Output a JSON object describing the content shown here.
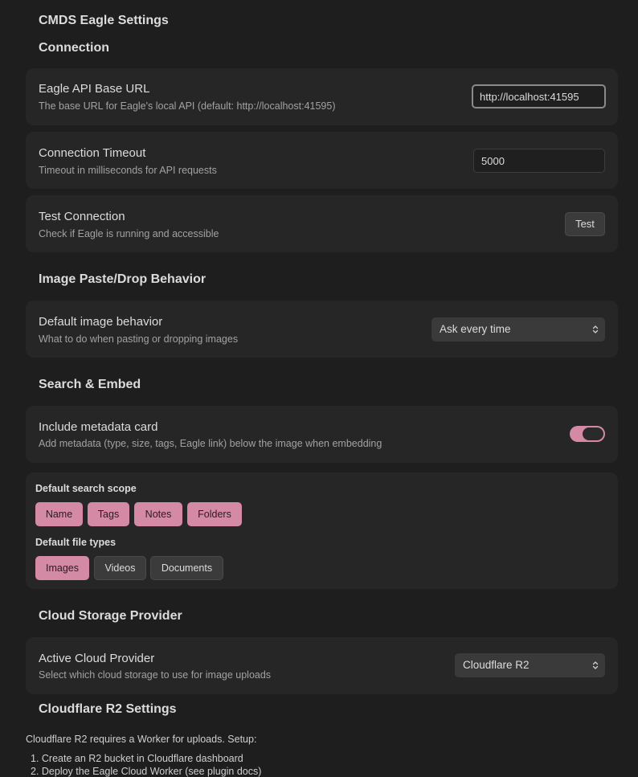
{
  "page_title": "CMDS Eagle Settings",
  "sections": {
    "connection": "Connection",
    "image_behavior": "Image Paste/Drop Behavior",
    "search_embed": "Search & Embed",
    "cloud_storage": "Cloud Storage Provider",
    "r2_settings": "Cloudflare R2 Settings"
  },
  "settings": {
    "base_url": {
      "name": "Eagle API Base URL",
      "desc": "The base URL for Eagle's local API (default: http://localhost:41595)",
      "value": "http://localhost:41595"
    },
    "timeout": {
      "name": "Connection Timeout",
      "desc": "Timeout in milliseconds for API requests",
      "value": "5000"
    },
    "test_connection": {
      "name": "Test Connection",
      "desc": "Check if Eagle is running and accessible",
      "button": "Test"
    },
    "image_behavior": {
      "name": "Default image behavior",
      "desc": "What to do when pasting or dropping images",
      "selected": "Ask every time"
    },
    "metadata_card": {
      "name": "Include metadata card",
      "desc": "Add metadata (type, size, tags, Eagle link) below the image when embedding",
      "enabled": true
    },
    "search_scope": {
      "label": "Default search scope",
      "chips": [
        {
          "label": "Name",
          "active": true
        },
        {
          "label": "Tags",
          "active": true
        },
        {
          "label": "Notes",
          "active": true
        },
        {
          "label": "Folders",
          "active": true
        }
      ]
    },
    "file_types": {
      "label": "Default file types",
      "chips": [
        {
          "label": "Images",
          "active": true
        },
        {
          "label": "Videos",
          "active": false
        },
        {
          "label": "Documents",
          "active": false
        }
      ]
    },
    "cloud_provider": {
      "name": "Active Cloud Provider",
      "desc": "Select which cloud storage to use for image uploads",
      "selected": "Cloudflare R2"
    }
  },
  "r2_info": {
    "intro": "Cloudflare R2 requires a Worker for uploads. Setup:",
    "steps": [
      "1. Create an R2 bucket in Cloudflare dashboard",
      "2. Deploy the Eagle Cloud Worker (see plugin docs)"
    ]
  },
  "colors": {
    "accent": "#d48aa5",
    "background": "#1e1e1e",
    "card": "#262626"
  }
}
